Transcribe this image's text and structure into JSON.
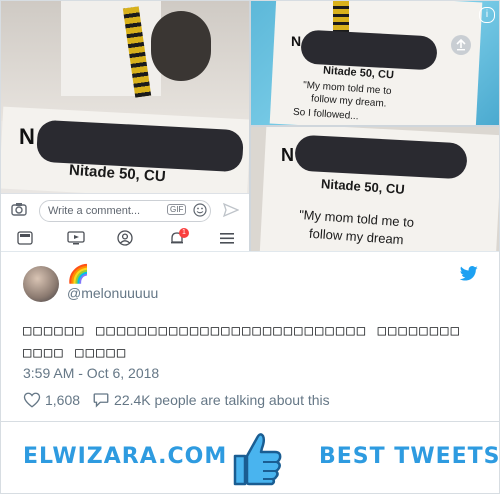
{
  "collage": {
    "left_photo": {
      "name_initial": "N",
      "school_line": "Nitade 50, CU"
    },
    "facebook_bar": {
      "comment_placeholder": "Write a comment...",
      "gif_label": "GIF",
      "notification_count": "1"
    },
    "top_right_photo": {
      "name_initial": "N",
      "school_line": "Nitade 50, CU",
      "quote_lines": [
        "\"My mom told me to",
        "follow my dream.",
        "So I followed..."
      ]
    },
    "bottom_right_photo": {
      "name_initial": "N",
      "school_line": "Nitade 50, CU",
      "quote_lines": [
        "\"My mom told me to",
        "follow my dream"
      ]
    }
  },
  "tweet": {
    "emoji": "🌈",
    "handle": "@melonuuuuu",
    "text": "□□□□□□ □□□□□□□□□□□□□□□□□□□□□□□□□□ □□□□□□□□ □□□□ □□□□□",
    "timestamp": "3:59 AM - Oct 6, 2018",
    "likes": "1,608",
    "talking": "22.4K people are talking about this"
  },
  "banner": {
    "site": "ELWIZARA.COM",
    "tagline": "BEST TWEETS"
  },
  "colors": {
    "twitter_blue": "#1da1f2",
    "brand_blue": "#2e9be0",
    "text_gray": "#657786"
  },
  "icons": [
    "camera-icon",
    "gif-icon",
    "emoji-icon",
    "send-icon",
    "newsfeed-icon",
    "video-icon",
    "profile-icon",
    "notification-bell-icon",
    "menu-icon",
    "info-icon",
    "upload-icon",
    "twitter-bird-icon",
    "heart-icon",
    "comment-icon",
    "thumbs-up-icon"
  ]
}
